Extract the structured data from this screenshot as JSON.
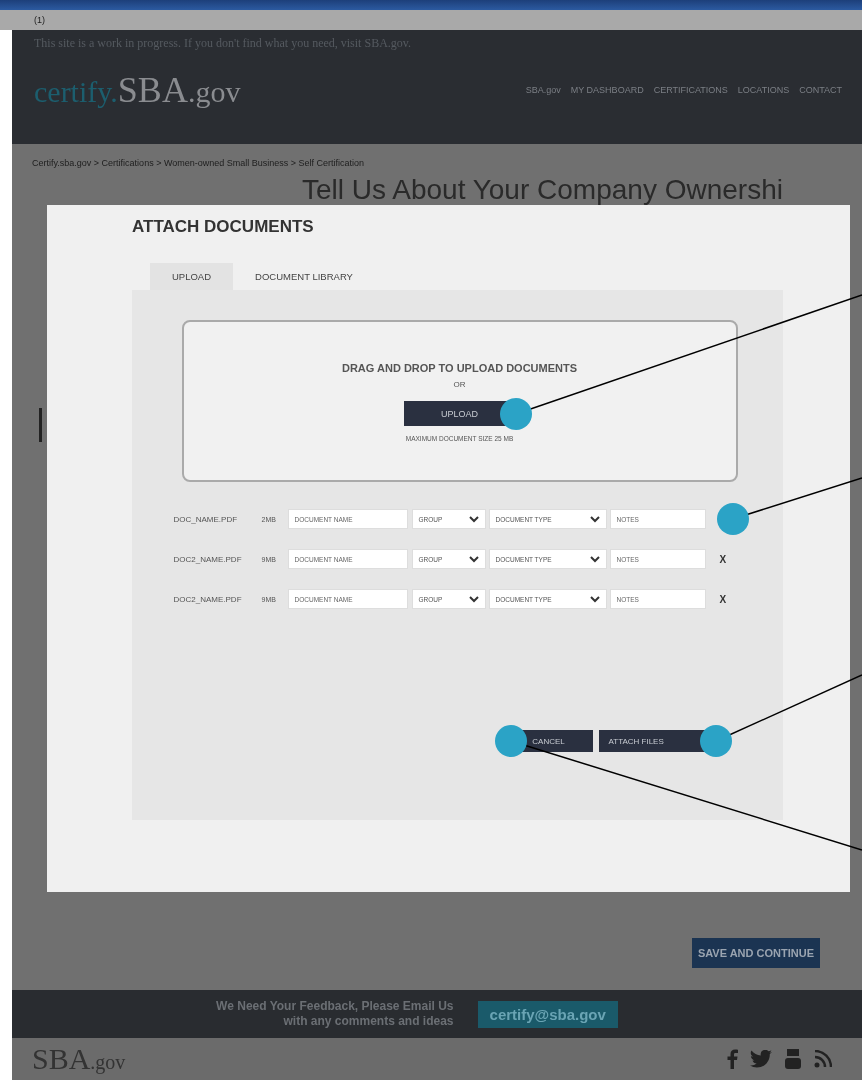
{
  "browser": {
    "tab_label": "(1)"
  },
  "banner": {
    "text": "This site is a work in progress. If you don't find what you need, visit SBA.gov."
  },
  "header": {
    "logo_prefix": "certify.",
    "logo_main": "SBA",
    "logo_suffix": ".gov",
    "nav": [
      "SBA.gov",
      "MY DASHBOARD",
      "CERTIFICATIONS",
      "LOCATIONS",
      "CONTACT"
    ]
  },
  "breadcrumb": "Certify.sba.gov > Certifications > Women-owned Small Business > Self Certification",
  "page_title": "Tell Us About Your Company Ownershi",
  "modal": {
    "title": "ATTACH DOCUMENTS",
    "tabs": [
      {
        "label": "UPLOAD",
        "selected": true
      },
      {
        "label": "DOCUMENT LIBRARY",
        "selected": false
      }
    ],
    "dropzone": {
      "heading": "DRAG AND DROP TO UPLOAD DOCUMENTS",
      "or": "OR",
      "button": "UPLOAD",
      "note": "MAXIMUM DOCUMENT SIZE 25 MB"
    },
    "files": [
      {
        "name": "DOC_NAME.PDF",
        "size": "2MB",
        "name_field": {
          "placeholder": "DOCUMENT NAME"
        },
        "group": "GROUP",
        "doc_type": "DOCUMENT TYPE",
        "notes_field": {
          "placeholder": "NOTES"
        }
      },
      {
        "name": "DOC2_NAME.PDF",
        "size": "9MB",
        "name_field": {
          "placeholder": "DOCUMENT NAME"
        },
        "group": "GROUP",
        "doc_type": "DOCUMENT TYPE",
        "notes_field": {
          "placeholder": "NOTES"
        },
        "remove": "X"
      },
      {
        "name": "DOC2_NAME.PDF",
        "size": "9MB",
        "name_field": {
          "placeholder": "DOCUMENT NAME"
        },
        "group": "GROUP",
        "doc_type": "DOCUMENT TYPE",
        "notes_field": {
          "placeholder": "NOTES"
        },
        "remove": "X"
      }
    ],
    "cancel": "CANCEL",
    "attach": "ATTACH FILES"
  },
  "save_button": "SAVE AND CONTINUE",
  "feedback": {
    "lines": [
      "We Need Your Feedback, Please Email Us",
      "with any comments and ideas"
    ],
    "email": "certify@sba.gov"
  },
  "footer": {
    "logo_main": "SBA",
    "logo_suffix": ".gov"
  }
}
